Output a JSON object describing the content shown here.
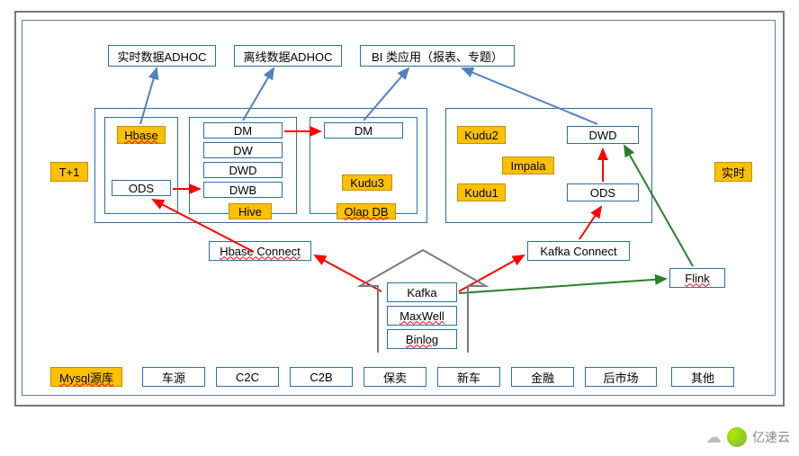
{
  "top": {
    "adhoc_rt": "实时数据ADHOC",
    "adhoc_off": "离线数据ADHOC",
    "bi": "BI 类应用（报表、专题）"
  },
  "left_side": {
    "label": "T+1"
  },
  "right_side": {
    "label": "实时"
  },
  "col_hbase": {
    "hbase": "Hbase",
    "ods": "ODS"
  },
  "col_hive": {
    "dm": "DM",
    "dw": "DW",
    "dwd": "DWD",
    "dwb": "DWB",
    "hive": "Hive"
  },
  "col_olap": {
    "dm": "DM",
    "kudu3": "Kudu3",
    "olap": "Olap DB"
  },
  "col_rt": {
    "kudu2": "Kudu2",
    "impala": "Impala",
    "kudu1": "Kudu1",
    "dwd": "DWD",
    "ods": "ODS"
  },
  "mid": {
    "hbase_connect": "Hbase Connect",
    "kafka_connect": "Kafka Connect",
    "flink": "Flink",
    "kafka": "Kafka",
    "maxwell": "MaxWell",
    "binlog": "Binlog"
  },
  "bottom": {
    "mysql": "Mysql源库",
    "cheyuan": "车源",
    "c2c": "C2C",
    "c2b": "C2B",
    "baomai": "保卖",
    "xinche": "新车",
    "jinrong": "金融",
    "houshichang": "后市场",
    "qita": "其他"
  },
  "watermark": "亿速云",
  "colors": {
    "orange": "#ffc000",
    "border_blue": "#2e6da3",
    "arrow_blue": "#4f81bd",
    "arrow_red": "#ff0000",
    "arrow_green": "#2d7d2d"
  }
}
